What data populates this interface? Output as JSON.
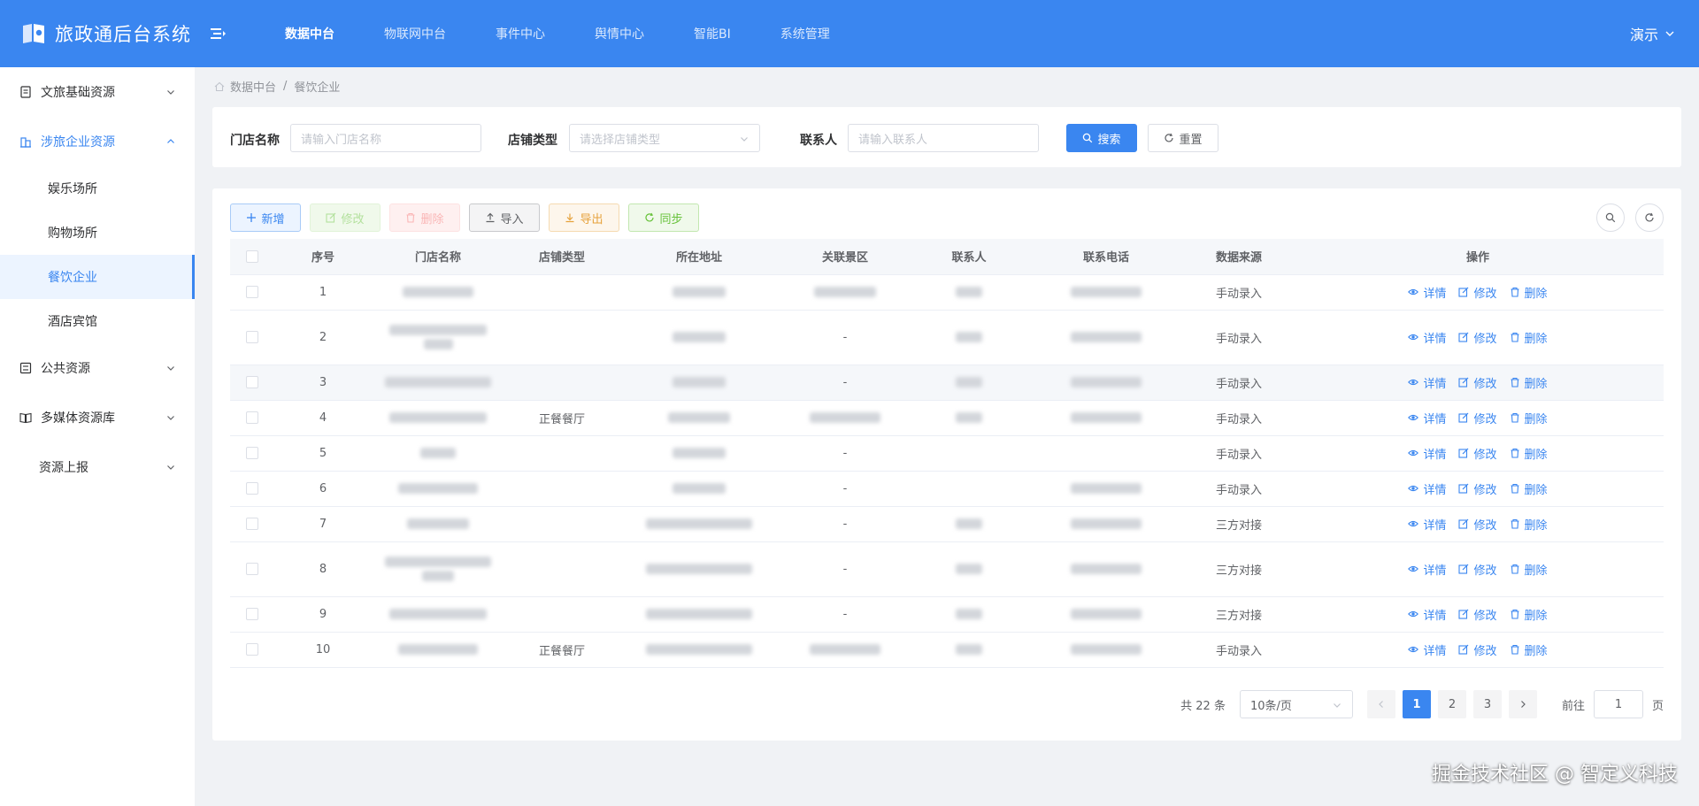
{
  "header": {
    "title": "旅政通后台系统",
    "nav": [
      "数据中台",
      "物联网中台",
      "事件中心",
      "舆情中心",
      "智能BI",
      "系统管理"
    ],
    "active_nav": 0,
    "user": "演示"
  },
  "sidebar": {
    "groups": [
      {
        "label": "文旅基础资源",
        "icon": "document-icon"
      },
      {
        "label": "涉旅企业资源",
        "icon": "building-icon",
        "open": true,
        "children": [
          "娱乐场所",
          "购物场所",
          "餐饮企业",
          "酒店宾馆"
        ],
        "active_child": 2
      },
      {
        "label": "公共资源",
        "icon": "list-icon"
      },
      {
        "label": "多媒体资源库",
        "icon": "book-icon"
      },
      {
        "label": "资源上报",
        "icon": ""
      }
    ]
  },
  "breadcrumb": [
    "数据中台",
    "餐饮企业"
  ],
  "search": {
    "store_name_label": "门店名称",
    "store_name_placeholder": "请输入门店名称",
    "store_type_label": "店铺类型",
    "store_type_placeholder": "请选择店铺类型",
    "contact_label": "联系人",
    "contact_placeholder": "请输入联系人",
    "search_button": "搜索",
    "reset_button": "重置"
  },
  "toolbar": {
    "add": "新增",
    "edit": "修改",
    "delete": "删除",
    "import": "导入",
    "export": "导出",
    "sync": "同步"
  },
  "table": {
    "columns": [
      "序号",
      "门店名称",
      "店铺类型",
      "所在地址",
      "关联景区",
      "联系人",
      "联系电话",
      "数据来源",
      "操作"
    ],
    "actions": [
      "详情",
      "修改",
      "删除"
    ],
    "rows": [
      {
        "no": "1",
        "type": "",
        "scenic": "",
        "source": "手动录入"
      },
      {
        "no": "2",
        "type": "",
        "scenic": "-",
        "source": "手动录入"
      },
      {
        "no": "3",
        "type": "",
        "scenic": "-",
        "source": "手动录入"
      },
      {
        "no": "4",
        "type": "正餐餐厅",
        "scenic": "",
        "source": "手动录入"
      },
      {
        "no": "5",
        "type": "",
        "scenic": "-",
        "source": "手动录入"
      },
      {
        "no": "6",
        "type": "",
        "scenic": "-",
        "source": "手动录入"
      },
      {
        "no": "7",
        "type": "",
        "scenic": "-",
        "source": "三方对接"
      },
      {
        "no": "8",
        "type": "",
        "scenic": "-",
        "source": "三方对接"
      },
      {
        "no": "9",
        "type": "",
        "scenic": "-",
        "source": "三方对接"
      },
      {
        "no": "10",
        "type": "正餐餐厅",
        "scenic": "",
        "source": "手动录入"
      }
    ]
  },
  "pagination": {
    "total_text": "共 22 条",
    "page_size": "10条/页",
    "pages": [
      "1",
      "2",
      "3"
    ],
    "current": 1,
    "goto_label": "前往",
    "goto_value": "1",
    "page_suffix": "页"
  },
  "watermark": "掘金技术社区 @ 智定义科技",
  "colors": {
    "primary": "#3a86f0",
    "header_bg": "#3a86f0",
    "page_bg": "#f0f2f5"
  }
}
